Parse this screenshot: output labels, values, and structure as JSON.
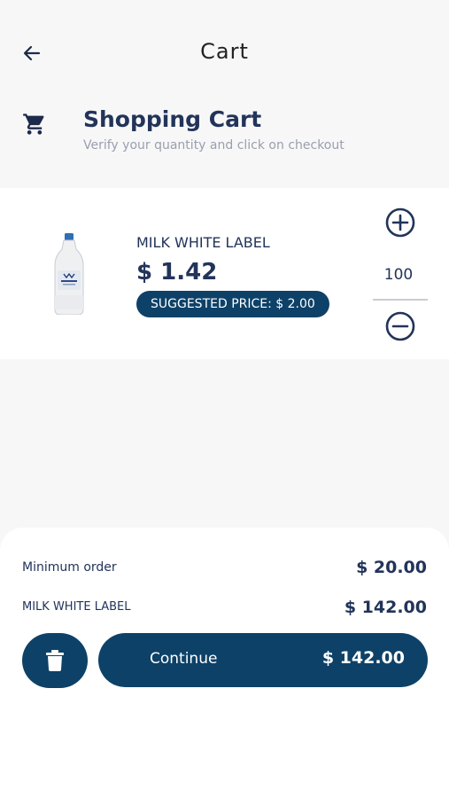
{
  "header": {
    "title": "Cart",
    "back_icon": "arrow-left-icon"
  },
  "section": {
    "icon": "shopping-cart-icon",
    "title": "Shopping Cart",
    "subtitle": "Verify your quantity and click on checkout"
  },
  "product": {
    "name": "MILK WHITE LABEL",
    "price": "$ 1.42",
    "suggested_price": "SUGGESTED PRICE: $ 2.00",
    "quantity": "100",
    "image": "milk-bottle-image"
  },
  "summary": {
    "min_order_label": "Minimum order",
    "min_order_value": "$ 20.00",
    "item_label": "MILK WHITE LABEL",
    "item_value": "$ 142.00"
  },
  "actions": {
    "continue_label": "Continue",
    "continue_total": "$ 142.00",
    "delete_icon": "trash-icon"
  },
  "colors": {
    "primary": "#0d4168",
    "text": "#22345a",
    "background": "#f7f7f8"
  }
}
